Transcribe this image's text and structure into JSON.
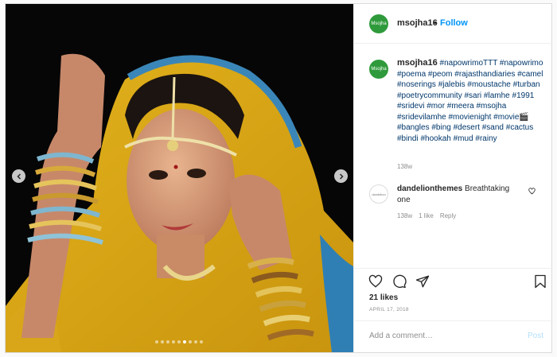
{
  "post": {
    "author": {
      "username": "msojha16",
      "avatar_text": "Msojha",
      "follow_label": "Follow",
      "separator": "•"
    },
    "photo": {
      "dots_count": 9,
      "active_dot": 5
    },
    "caption": {
      "username": "msojha16",
      "hashtags": "#napowrimoTTT #napowrimo #poema #peom #rajasthandiaries #camel #noserings #jalebis #moustache #turban #poetrycommunity #sari #lamhe #1991 #sridevi #mor #meera #msojha #sridevilamhe #movienight #movie🎬 #bangles #bing #desert #sand #cactus #bindi #hookah #mud #rainy",
      "time": "138w"
    },
    "comments": [
      {
        "username": "dandelionthemes",
        "text": "Breathtaking one",
        "time": "138w",
        "likes": "1 like",
        "reply_label": "Reply",
        "avatar_text": "dandelion"
      }
    ],
    "likes_text": "21 likes",
    "date": "APRIL 17, 2018",
    "add_comment_placeholder": "Add a comment…",
    "post_label": "Post"
  },
  "colors": {
    "follow_blue": "#0095f6",
    "hashtag_blue": "#00376b",
    "muted_gray": "#8e8e8e",
    "avatar_green": "#2f9a3b",
    "post_disabled": "#b2dffc"
  },
  "icons": [
    "chevron-left-icon",
    "chevron-right-icon",
    "heart-icon",
    "comment-icon",
    "share-icon",
    "bookmark-icon"
  ]
}
